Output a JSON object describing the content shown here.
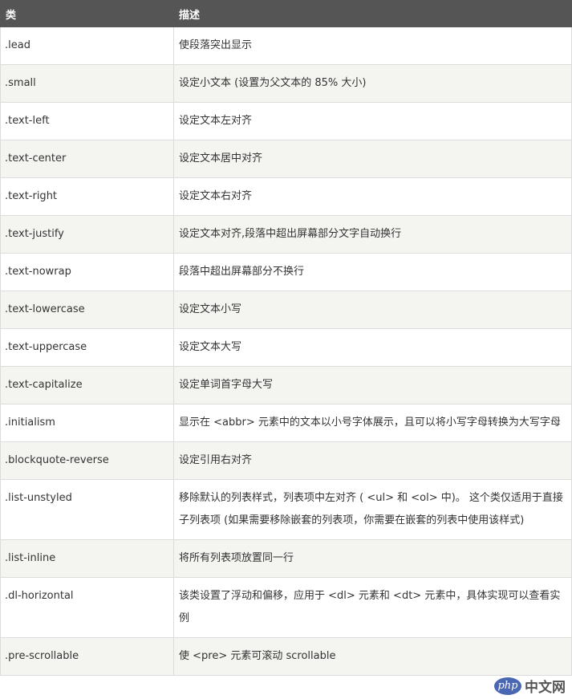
{
  "table": {
    "headers": [
      "类",
      "描述"
    ],
    "rows": [
      {
        "cls": ".lead",
        "desc": "使段落突出显示"
      },
      {
        "cls": ".small",
        "desc": "设定小文本 (设置为父文本的 85% 大小)"
      },
      {
        "cls": ".text-left",
        "desc": "设定文本左对齐"
      },
      {
        "cls": ".text-center",
        "desc": "设定文本居中对齐"
      },
      {
        "cls": ".text-right",
        "desc": "设定文本右对齐"
      },
      {
        "cls": ".text-justify",
        "desc": "设定文本对齐,段落中超出屏幕部分文字自动换行"
      },
      {
        "cls": ".text-nowrap",
        "desc": "段落中超出屏幕部分不换行"
      },
      {
        "cls": ".text-lowercase",
        "desc": "设定文本小写"
      },
      {
        "cls": ".text-uppercase",
        "desc": "设定文本大写"
      },
      {
        "cls": ".text-capitalize",
        "desc": "设定单词首字母大写"
      },
      {
        "cls": ".initialism",
        "desc": "显示在 <abbr> 元素中的文本以小号字体展示，且可以将小写字母转换为大写字母"
      },
      {
        "cls": ".blockquote-reverse",
        "desc": "设定引用右对齐"
      },
      {
        "cls": ".list-unstyled",
        "desc": "移除默认的列表样式，列表项中左对齐 ( <ul> 和 <ol> 中)。 这个类仅适用于直接子列表项 (如果需要移除嵌套的列表项，你需要在嵌套的列表中使用该样式)"
      },
      {
        "cls": ".list-inline",
        "desc": "将所有列表项放置同一行"
      },
      {
        "cls": ".dl-horizontal",
        "desc": "该类设置了浮动和偏移，应用于 <dl> 元素和 <dt> 元素中，具体实现可以查看实例"
      },
      {
        "cls": ".pre-scrollable",
        "desc": "使 <pre> 元素可滚动 scrollable"
      }
    ]
  },
  "watermark": {
    "logo": "php",
    "text": "中文网",
    "icon": "php-logo-icon"
  }
}
